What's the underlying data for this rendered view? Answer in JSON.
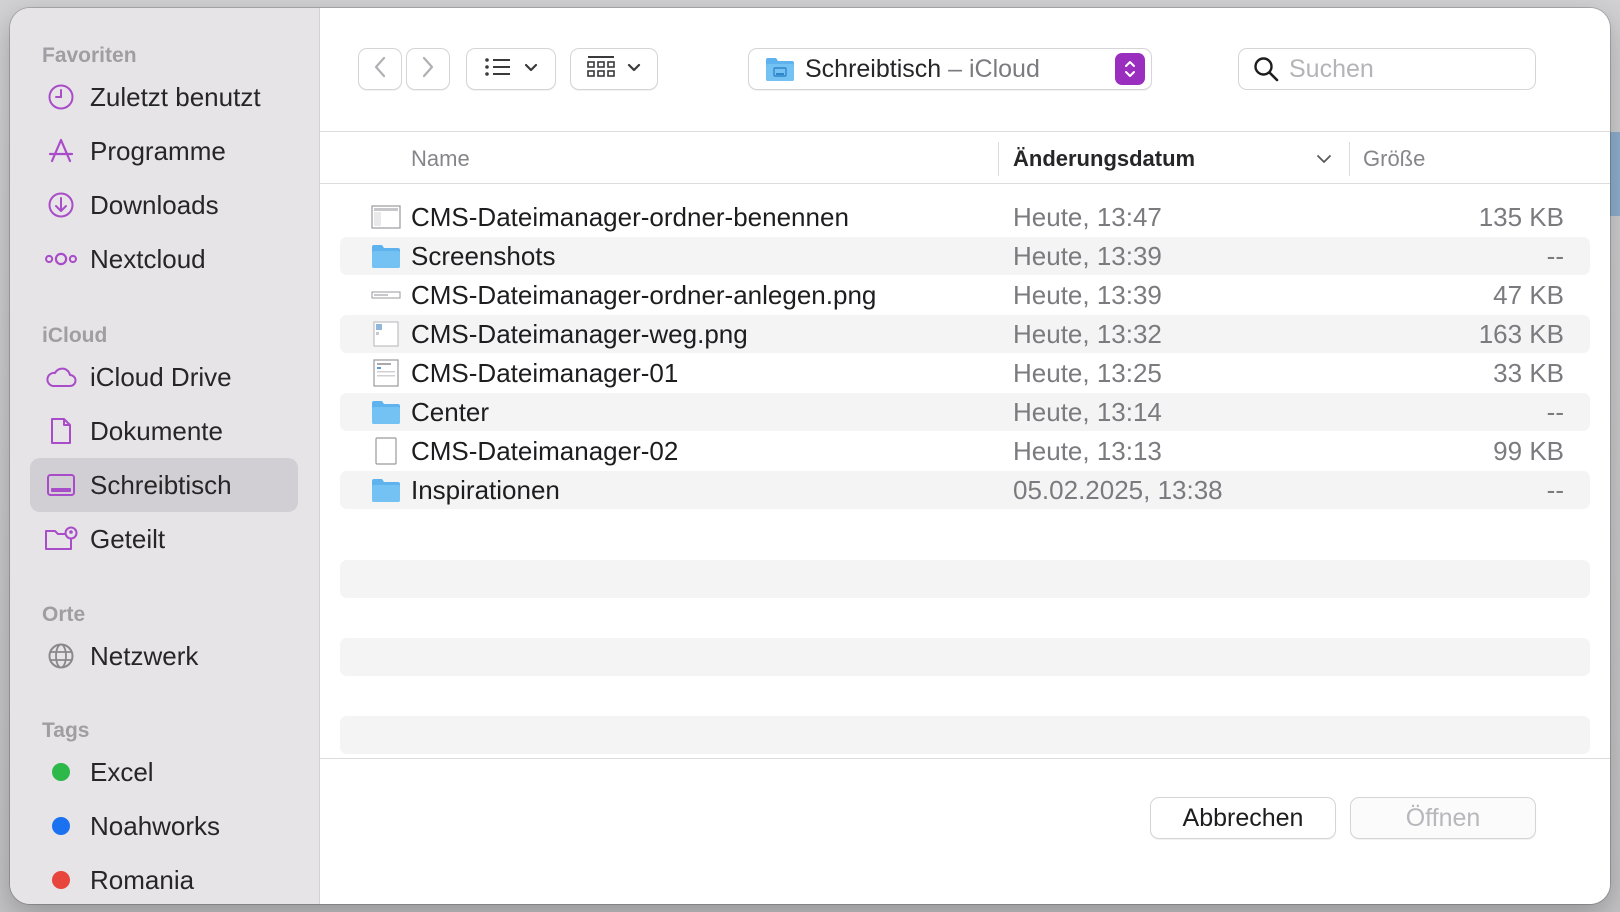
{
  "sidebar": {
    "sections": [
      {
        "title": "Favoriten",
        "items": [
          {
            "label": "Zuletzt benutzt",
            "icon": "clock-icon"
          },
          {
            "label": "Programme",
            "icon": "apps-icon"
          },
          {
            "label": "Downloads",
            "icon": "download-icon"
          },
          {
            "label": "Nextcloud",
            "icon": "nextcloud-icon"
          }
        ]
      },
      {
        "title": "iCloud",
        "items": [
          {
            "label": "iCloud Drive",
            "icon": "cloud-icon"
          },
          {
            "label": "Dokumente",
            "icon": "document-icon"
          },
          {
            "label": "Schreibtisch",
            "icon": "desktop-icon",
            "selected": true
          },
          {
            "label": "Geteilt",
            "icon": "shared-folder-icon"
          }
        ]
      },
      {
        "title": "Orte",
        "items": [
          {
            "label": "Netzwerk",
            "icon": "globe-icon"
          }
        ]
      },
      {
        "title": "Tags",
        "items": [
          {
            "label": "Excel",
            "color": "#2db84a"
          },
          {
            "label": "Noahworks",
            "color": "#1a72f0"
          },
          {
            "label": "Romania",
            "color": "#e8453c"
          }
        ]
      }
    ]
  },
  "toolbar": {
    "location": "Schreibtisch",
    "location_suffix": " – iCloud",
    "search_placeholder": "Suchen",
    "accent": "#9a2fbf"
  },
  "columns": {
    "name": "Name",
    "date": "Änderungsdatum",
    "size": "Größe"
  },
  "files": [
    {
      "name": "CMS-Dateimanager-ordner-benennen",
      "date": "Heute, 13:47",
      "size": "135 KB",
      "type": "image"
    },
    {
      "name": "Screenshots",
      "date": "Heute, 13:39",
      "size": "--",
      "type": "folder"
    },
    {
      "name": "CMS-Dateimanager-ordner-anlegen.png",
      "date": "Heute, 13:39",
      "size": "47 KB",
      "type": "image-wide"
    },
    {
      "name": "CMS-Dateimanager-weg.png",
      "date": "Heute, 13:32",
      "size": "163 KB",
      "type": "image-doc"
    },
    {
      "name": "CMS-Dateimanager-01",
      "date": "Heute, 13:25",
      "size": "33 KB",
      "type": "image-doc"
    },
    {
      "name": "Center",
      "date": "Heute, 13:14",
      "size": "--",
      "type": "folder"
    },
    {
      "name": "CMS-Dateimanager-02",
      "date": "Heute, 13:13",
      "size": "99 KB",
      "type": "blank"
    },
    {
      "name": "Inspirationen",
      "date": "05.02.2025, 13:38",
      "size": "--",
      "type": "folder"
    }
  ],
  "buttons": {
    "cancel": "Abbrechen",
    "open": "Öffnen"
  }
}
